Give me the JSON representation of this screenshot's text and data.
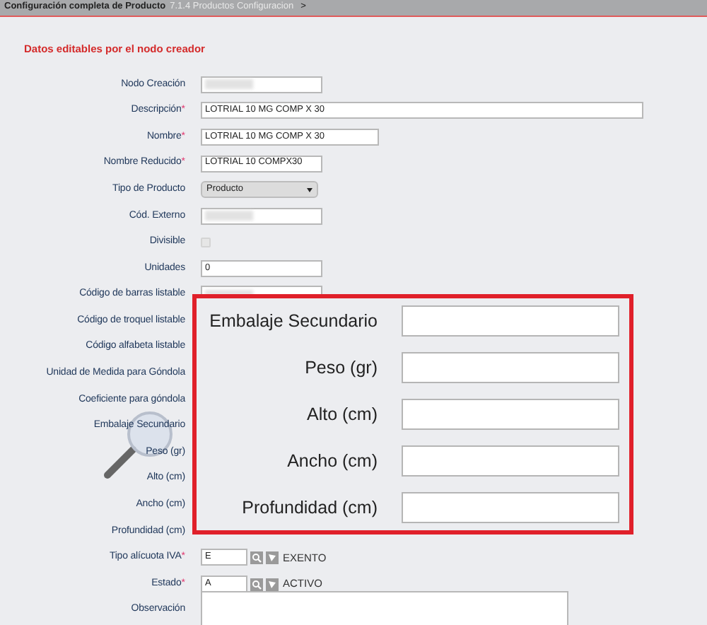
{
  "breadcrumb": {
    "title": "Configuración completa de Producto",
    "path": "7.1.4 Productos Configuracion",
    "separator": ">"
  },
  "section_title": "Datos editables por el nodo creador",
  "required_marker": "*",
  "fields": [
    {
      "label": "Nodo Creación",
      "required": false,
      "kind": "redacted"
    },
    {
      "label": "Descripción",
      "required": true,
      "kind": "wide",
      "value": "LOTRIAL  10   MG COMP X 30"
    },
    {
      "label": "Nombre",
      "required": true,
      "kind": "medium",
      "value": "LOTRIAL  10   MG COMP X 30"
    },
    {
      "label": "Nombre Reducido",
      "required": true,
      "kind": "text",
      "value": "LOTRIAL 10   COMPX30"
    },
    {
      "label": "Tipo de Producto",
      "required": false,
      "kind": "select",
      "value": "Producto"
    },
    {
      "label": "Cód. Externo",
      "required": false,
      "kind": "redacted"
    },
    {
      "label": "Divisible",
      "required": false,
      "kind": "checkbox",
      "checked": false
    },
    {
      "label": "Unidades",
      "required": false,
      "kind": "text",
      "value": "0"
    },
    {
      "label": "Código de barras listable",
      "required": false,
      "kind": "redacted_partial"
    },
    {
      "label": "Código de troquel listable",
      "required": false,
      "kind": "label"
    },
    {
      "label": "Código alfabeta listable",
      "required": false,
      "kind": "label"
    },
    {
      "label": "Unidad de Medida para Góndola",
      "required": false,
      "kind": "label"
    },
    {
      "label": "Coeficiente para góndola",
      "required": false,
      "kind": "label"
    },
    {
      "label": "Embalaje Secundario",
      "required": false,
      "kind": "label"
    },
    {
      "label": "Peso (gr)",
      "required": false,
      "kind": "label"
    },
    {
      "label": "Alto (cm)",
      "required": false,
      "kind": "label"
    },
    {
      "label": "Ancho (cm)",
      "required": false,
      "kind": "label"
    },
    {
      "label": "Profundidad (cm)",
      "required": false,
      "kind": "label"
    },
    {
      "label": "Tipo alícuota IVA",
      "required": true,
      "kind": "lookup",
      "value": "E",
      "description": "EXENTO"
    },
    {
      "label": "Estado",
      "required": true,
      "kind": "lookup",
      "value": "A",
      "description": "ACTIVO"
    },
    {
      "label": "Observación",
      "required": false,
      "kind": "textarea"
    }
  ],
  "zoom_panel": {
    "fields": [
      {
        "label": "Embalaje Secundario"
      },
      {
        "label": "Peso (gr)"
      },
      {
        "label": "Alto (cm)"
      },
      {
        "label": "Ancho (cm)"
      },
      {
        "label": "Profundidad (cm)"
      }
    ]
  }
}
